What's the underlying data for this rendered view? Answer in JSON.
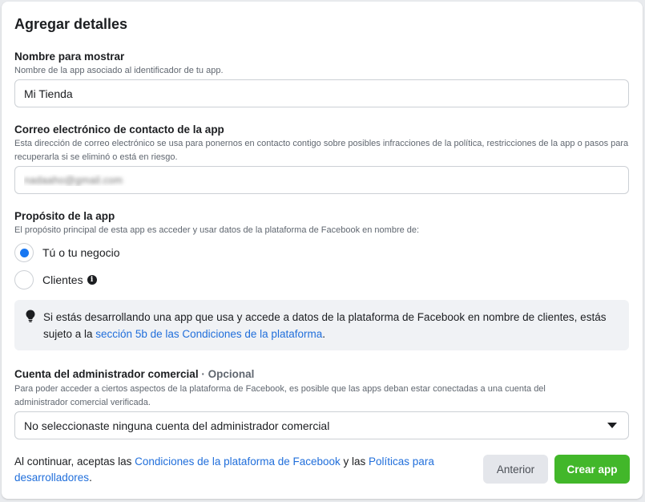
{
  "header": {
    "title": "Agregar detalles"
  },
  "display_name": {
    "label": "Nombre para mostrar",
    "help": "Nombre de la app asociado al identificador de tu app.",
    "value": "Mi Tienda"
  },
  "contact_email": {
    "label": "Correo electrónico de contacto de la app",
    "help": "Esta dirección de correo electrónico se usa para ponernos en contacto contigo sobre posibles infracciones de la política, restricciones de la app o pasos para recuperarla si se eliminó o está en riesgo.",
    "value": "nadaaho@gmail.com"
  },
  "purpose": {
    "label": "Propósito de la app",
    "help": "El propósito principal de esta app es acceder y usar datos de la plataforma de Facebook en nombre de:",
    "options": [
      {
        "label": "Tú o tu negocio",
        "checked": true
      },
      {
        "label": "Clientes",
        "checked": false,
        "icon": "info-icon"
      }
    ]
  },
  "notice": {
    "icon": "lightbulb-icon",
    "text_before": "Si estás desarrollando una app que usa y accede a datos de la plataforma de Facebook en nombre de clientes, estás sujeto a la ",
    "link": "sección 5b de las Condiciones de la plataforma",
    "text_after": "."
  },
  "business_account": {
    "label": "Cuenta del administrador comercial",
    "optional": " · Opcional",
    "help": "Para poder acceder a ciertos aspectos de la plataforma de Facebook, es posible que las apps deban estar conectadas a una cuenta del administrador comercial verificada.",
    "selected": "No seleccionaste ninguna cuenta del administrador comercial"
  },
  "footer": {
    "text_1": "Al continuar, aceptas las ",
    "link_1": "Condiciones de la plataforma de Facebook",
    "text_2": " y las ",
    "link_2": "Políticas para desarrolladores",
    "text_3": ".",
    "back_label": "Anterior",
    "create_label": "Crear app"
  },
  "colors": {
    "accent": "#1877f2",
    "link": "#216fdb",
    "primary_button": "#42b72a"
  }
}
